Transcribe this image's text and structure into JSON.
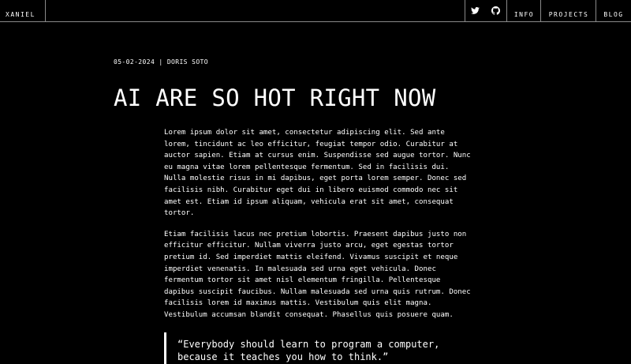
{
  "header": {
    "brand": "XANIEL",
    "icons": [
      "twitter-icon",
      "github-icon"
    ],
    "nav": [
      "INFO",
      "PROJECTS",
      "BLOG"
    ]
  },
  "post": {
    "meta": "05-02-2024 | DORIS SOTO",
    "title": "AI ARE SO HOT RIGHT NOW",
    "paragraphs": [
      "Lorem ipsum dolor sit amet, consectetur adipiscing elit. Sed ante lorem, tincidunt ac leo efficitur, feugiat tempor odio. Curabitur at auctor sapien. Etiam at cursus enim. Suspendisse sed augue tortor. Nunc eu magna vitae lorem pellentesque fermentum. Sed in facilisis dui. Nulla molestie risus in mi dapibus, eget porta lorem semper. Donec sed facilisis nibh. Curabitur eget dui in libero euismod commodo nec sit amet est. Etiam id ipsum aliquam, vehicula erat sit amet, consequat tortor.",
      "Etiam facilisis lacus nec pretium lobortis. Praesent dapibus justo non efficitur efficitur. Nullam viverra justo arcu, eget egestas tortor pretium id. Sed imperdiet mattis eleifend. Vivamus suscipit et neque imperdiet venenatis. In malesuada sed urna eget vehicula. Donec fermentum tortor sit amet nisl elementum fringilla. Pellentesque dapibus suscipit faucibus. Nullam malesuada sed urna quis rutrum. Donec facilisis lorem id maximus mattis. Vestibulum quis elit magna. Vestibulum accumsan blandit consequat. Phasellus quis posuere quam."
    ],
    "quote": "“Everybody should learn to program a computer, because it teaches you how to think.”"
  }
}
